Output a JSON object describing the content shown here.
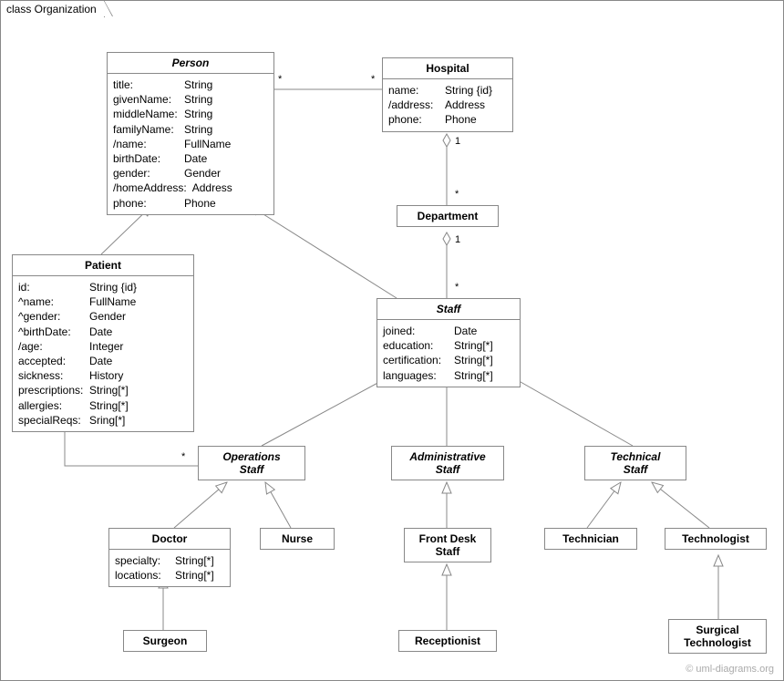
{
  "frame": {
    "title": "class Organization"
  },
  "classes": {
    "person": {
      "name": "Person",
      "attrs": [
        {
          "k": "title:",
          "v": "String"
        },
        {
          "k": "givenName:",
          "v": "String"
        },
        {
          "k": "middleName:",
          "v": "String"
        },
        {
          "k": "familyName:",
          "v": "String"
        },
        {
          "k": "/name:",
          "v": "FullName"
        },
        {
          "k": "birthDate:",
          "v": "Date"
        },
        {
          "k": "gender:",
          "v": "Gender"
        },
        {
          "k": "/homeAddress:",
          "v": "Address"
        },
        {
          "k": "phone:",
          "v": "Phone"
        }
      ]
    },
    "hospital": {
      "name": "Hospital",
      "attrs": [
        {
          "k": "name:",
          "v": "String {id}"
        },
        {
          "k": "/address:",
          "v": "Address"
        },
        {
          "k": "phone:",
          "v": "Phone"
        }
      ]
    },
    "department": {
      "name": "Department"
    },
    "patient": {
      "name": "Patient",
      "attrs": [
        {
          "k": "id:",
          "v": "String {id}"
        },
        {
          "k": "^name:",
          "v": "FullName"
        },
        {
          "k": "^gender:",
          "v": "Gender"
        },
        {
          "k": "^birthDate:",
          "v": "Date"
        },
        {
          "k": "/age:",
          "v": "Integer"
        },
        {
          "k": "accepted:",
          "v": "Date"
        },
        {
          "k": "sickness:",
          "v": "History"
        },
        {
          "k": "prescriptions:",
          "v": "String[*]"
        },
        {
          "k": "allergies:",
          "v": "String[*]"
        },
        {
          "k": "specialReqs:",
          "v": "Sring[*]"
        }
      ]
    },
    "staff": {
      "name": "Staff",
      "attrs": [
        {
          "k": "joined:",
          "v": "Date"
        },
        {
          "k": "education:",
          "v": "String[*]"
        },
        {
          "k": "certification:",
          "v": "String[*]"
        },
        {
          "k": "languages:",
          "v": "String[*]"
        }
      ]
    },
    "op_staff": {
      "name": "Operations Staff",
      "name_l1": "Operations",
      "name_l2": "Staff"
    },
    "admin_staff": {
      "name": "Administrative Staff",
      "name_l1": "Administrative",
      "name_l2": "Staff"
    },
    "tech_staff": {
      "name": "Technical Staff",
      "name_l1": "Technical",
      "name_l2": "Staff"
    },
    "doctor": {
      "name": "Doctor",
      "attrs": [
        {
          "k": "specialty:",
          "v": "String[*]"
        },
        {
          "k": "locations:",
          "v": "String[*]"
        }
      ]
    },
    "nurse": {
      "name": "Nurse"
    },
    "frontdesk": {
      "name_l1": "Front Desk",
      "name_l2": "Staff"
    },
    "receptionist": {
      "name": "Receptionist"
    },
    "technician": {
      "name": "Technician"
    },
    "technologist": {
      "name": "Technologist"
    },
    "surg_tech": {
      "name_l1": "Surgical",
      "name_l2": "Technologist"
    },
    "surgeon": {
      "name": "Surgeon"
    }
  },
  "mult": {
    "person_hosp_l": "*",
    "person_hosp_r": "*",
    "hosp_dept_1": "1",
    "hosp_dept_star": "*",
    "dept_staff_1": "1",
    "dept_staff_star": "*",
    "patient_opstaff_l": "*",
    "patient_opstaff_r": "*"
  },
  "watermark": "© uml-diagrams.org"
}
